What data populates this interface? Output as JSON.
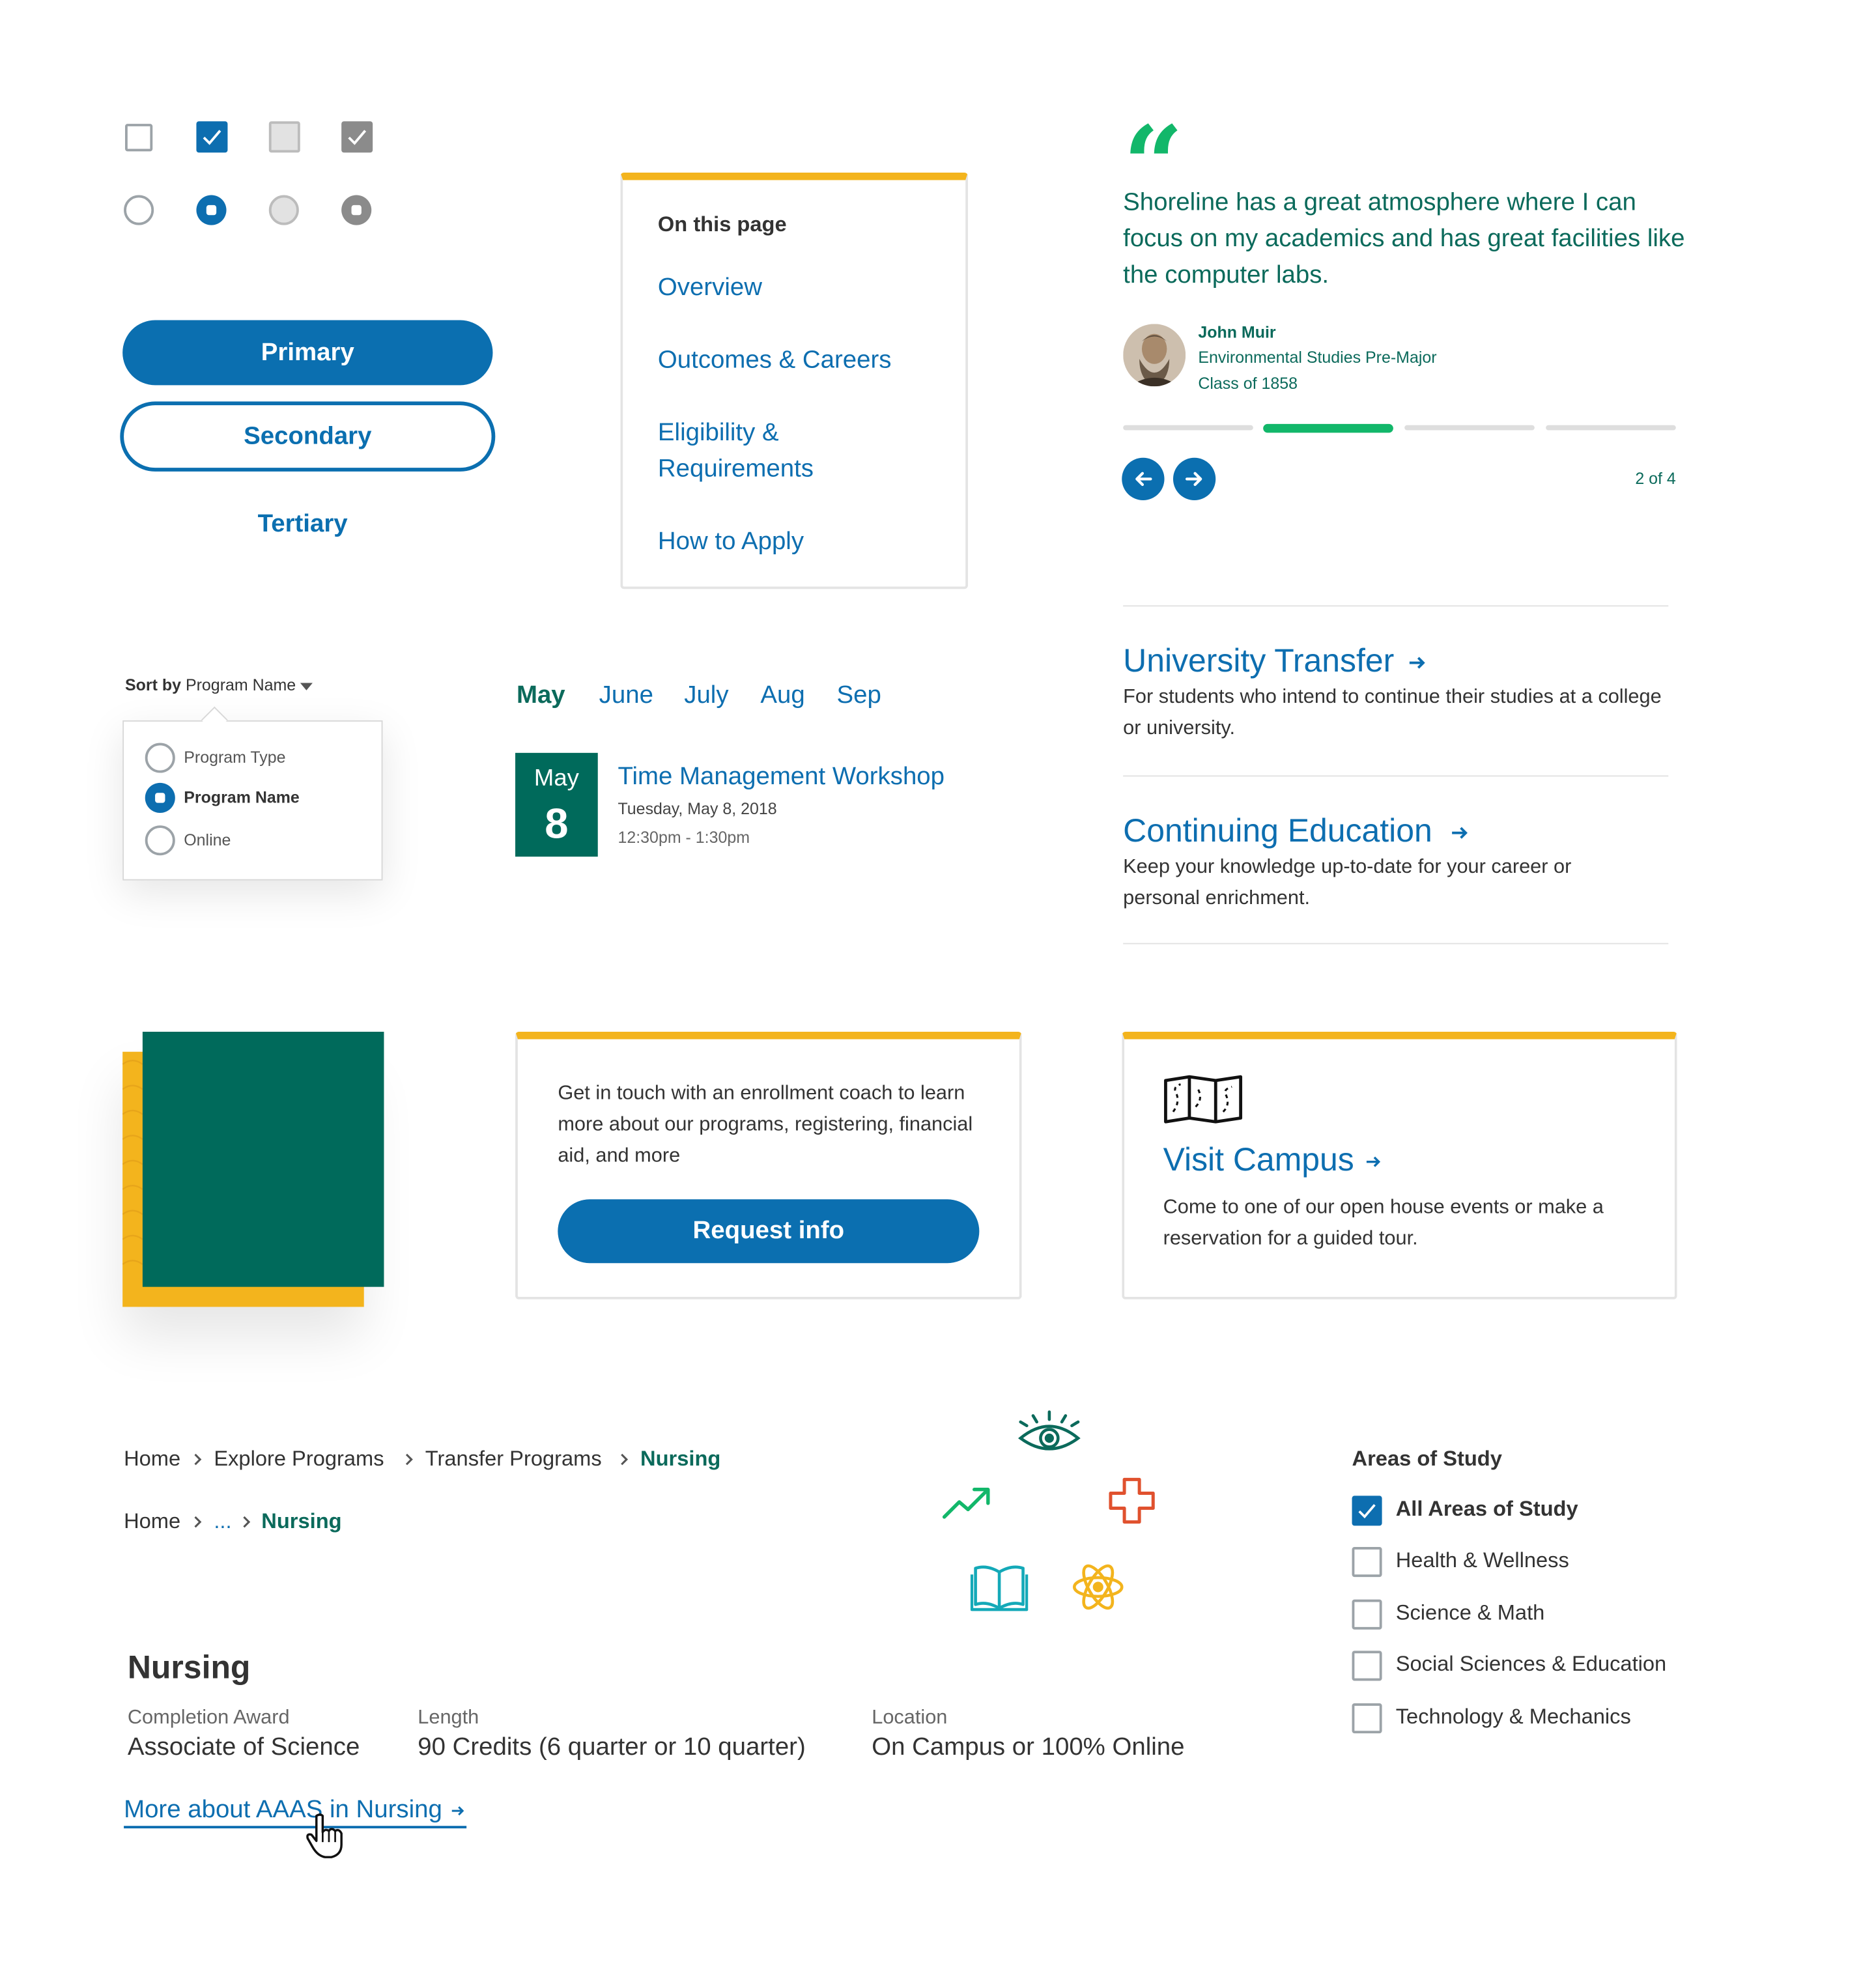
{
  "form_controls": {
    "checkbox_states": [
      "unchecked",
      "checked",
      "disabled",
      "disabled-checked"
    ],
    "radio_states": [
      "unselected",
      "selected",
      "disabled",
      "disabled-selected"
    ]
  },
  "buttons": {
    "primary": "Primary",
    "secondary": "Secondary",
    "tertiary": "Tertiary"
  },
  "on_this_page": {
    "title": "On this page",
    "links": [
      "Overview",
      "Outcomes & Careers",
      "Eligibility & Requirements",
      "How to Apply"
    ]
  },
  "testimonial": {
    "quote_mark": "“",
    "quote": "Shoreline has a great atmosphere where I can focus on my academics and has great facilities like the computer labs.",
    "name": "John Muir",
    "program": "Environmental Studies Pre-Major",
    "class_year": "Class of 1858",
    "counter": "2 of 4",
    "current_index": 2,
    "total": 4
  },
  "link_cards": [
    {
      "title": "University Transfer",
      "description": "For students who intend to continue their studies at a college or university."
    },
    {
      "title": "Continuing Education",
      "description": "Keep your knowledge up-to-date for your career or personal enrichment."
    }
  ],
  "sort": {
    "label": "Sort by",
    "selected": "Program Name",
    "options": [
      "Program Type",
      "Program Name",
      "Online"
    ]
  },
  "months": {
    "active": "May",
    "items": [
      "June",
      "July",
      "Aug",
      "Sep"
    ]
  },
  "event": {
    "month": "May",
    "day": "8",
    "title": "Time Management Workshop",
    "date": "Tuesday, May 8, 2018",
    "time": "12:30pm - 1:30pm"
  },
  "enrollment_card": {
    "text": "Get in touch with an enrollment coach to learn more about our programs, registering, financial aid, and more",
    "button": "Request info"
  },
  "visit_card": {
    "icon": "map-icon",
    "title": "Visit Campus",
    "text": "Come to one of our open house events or make a reservation for a guided tour."
  },
  "breadcrumb_full": [
    "Home",
    "Explore Programs",
    "Transfer Programs",
    "Nursing"
  ],
  "breadcrumb_short": [
    "Home",
    "...",
    "Nursing"
  ],
  "icons": [
    {
      "name": "eye-icon",
      "color": "#0b6a5b"
    },
    {
      "name": "trending-up-icon",
      "color": "#12b76a"
    },
    {
      "name": "medical-cross-icon",
      "color": "#e0512e"
    },
    {
      "name": "open-book-icon",
      "color": "#14a9b8"
    },
    {
      "name": "atom-icon",
      "color": "#f3b41d"
    }
  ],
  "program": {
    "title": "Nursing",
    "completion_award_label": "Completion Award",
    "completion_award": "Associate of Science",
    "length_label": "Length",
    "length": "90 Credits (6 quarter or 10 quarter)",
    "location_label": "Location",
    "location": "On Campus or 100% Online",
    "more_link": "More about AAAS in Nursing"
  },
  "areas_of_study": {
    "title": "Areas of Study",
    "items": [
      {
        "label": "All Areas of Study",
        "checked": true
      },
      {
        "label": "Health & Wellness",
        "checked": false
      },
      {
        "label": "Science & Math",
        "checked": false
      },
      {
        "label": "Social Sciences & Education",
        "checked": false
      },
      {
        "label": "Technology & Mechanics",
        "checked": false
      }
    ]
  },
  "colors": {
    "brand_blue": "#0b6fb0",
    "brand_green": "#006a5b",
    "accent_yellow": "#f3b41d",
    "accent_green": "#12b76a"
  }
}
